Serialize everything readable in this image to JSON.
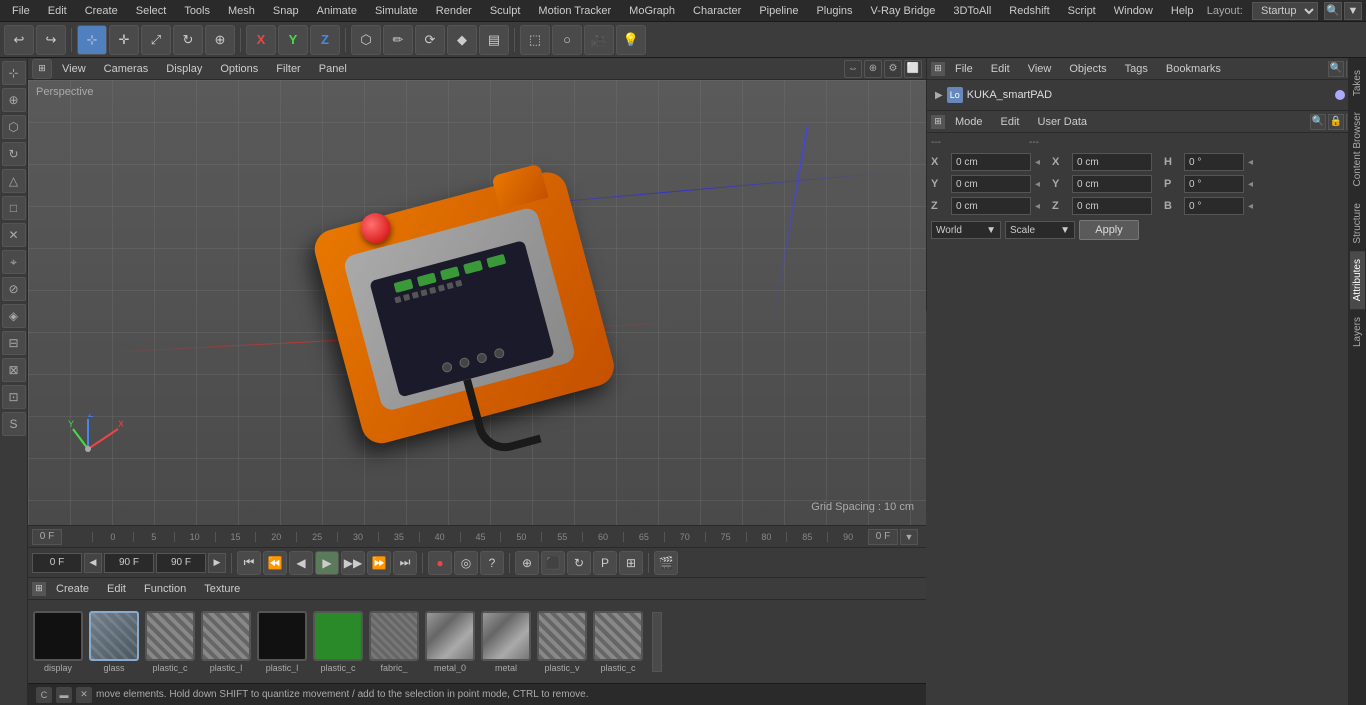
{
  "menu": {
    "items": [
      "File",
      "Edit",
      "Create",
      "Select",
      "Tools",
      "Mesh",
      "Snap",
      "Animate",
      "Simulate",
      "Render",
      "Sculpt",
      "Motion Tracker",
      "MoGraph",
      "Character",
      "Pipeline",
      "Plugins",
      "V-Ray Bridge",
      "3DToAll",
      "Redshift",
      "Script",
      "Window",
      "Help"
    ],
    "layout_label": "Layout:",
    "layout_value": "Startup"
  },
  "toolbar": {
    "undo_icon": "↩",
    "redo_icon": "↪",
    "move_icon": "✛",
    "scale_icon": "⤢",
    "rotate_icon": "↻",
    "axis_x": "X",
    "axis_y": "Y",
    "axis_z": "Z"
  },
  "viewport": {
    "label": "Perspective",
    "menu_items": [
      "View",
      "Cameras",
      "Display",
      "Options",
      "Filter",
      "Panel"
    ],
    "grid_spacing": "Grid Spacing : 10 cm"
  },
  "timeline": {
    "marks": [
      "0",
      "5",
      "10",
      "15",
      "20",
      "25",
      "30",
      "35",
      "40",
      "45",
      "50",
      "55",
      "60",
      "65",
      "70",
      "75",
      "80",
      "85",
      "90"
    ],
    "current_frame": "0 F",
    "start_frame": "0 F",
    "end_frame": "90 F",
    "end_frame2": "90 F"
  },
  "playback": {
    "frame_display": "0 F",
    "btn_start": "⏮",
    "btn_prev_key": "⏪",
    "btn_prev": "◀",
    "btn_play": "▶",
    "btn_next": "▶",
    "btn_next_key": "⏩",
    "btn_end": "⏭",
    "btn_record": "⏺",
    "btn_auto_key": "A",
    "btn_question": "?",
    "btn_move": "+",
    "btn_scale": "⬛",
    "btn_rotate": "↻",
    "btn_p": "P",
    "btn_grid": "⊞",
    "btn_render": "🎬"
  },
  "right_panel": {
    "top_menu": [
      "File",
      "Edit",
      "View",
      "Objects",
      "Tags",
      "Bookmarks"
    ],
    "object_name": "KUKA_smartPAD",
    "object_icon": "Lo",
    "dot1_color": "#aaaaff",
    "dot2_color": "#ff6666",
    "bottom_menu": [
      "Mode",
      "Edit",
      "User Data"
    ],
    "sections": {
      "empty_label": "---"
    }
  },
  "attributes": {
    "section1": "---",
    "section2": "---",
    "rows": [
      {
        "label": "X",
        "val1": "0 cm",
        "arrow": "◂",
        "label2": "X",
        "val2": "0 cm",
        "label3": "H",
        "val3": "0 °",
        "arrow2": "◂"
      },
      {
        "label": "Y",
        "val1": "0 cm",
        "arrow": "◂",
        "label2": "Y",
        "val2": "0 cm",
        "label3": "P",
        "val3": "0 °",
        "arrow2": "◂"
      },
      {
        "label": "Z",
        "val1": "0 cm",
        "arrow": "◂",
        "label2": "Z",
        "val2": "0 cm",
        "label3": "B",
        "val3": "0 °",
        "arrow2": "◂"
      }
    ],
    "world_label": "World",
    "scale_label": "Scale",
    "apply_label": "Apply"
  },
  "materials": {
    "menu_items": [
      "Create",
      "Edit",
      "Function",
      "Texture"
    ],
    "items": [
      {
        "name": "display",
        "type": "black"
      },
      {
        "name": "glass",
        "type": "glass"
      },
      {
        "name": "plastic_c",
        "type": "plastic-c"
      },
      {
        "name": "plastic_l",
        "type": "plastic-c"
      },
      {
        "name": "plastic_l",
        "type": "black"
      },
      {
        "name": "plastic_c",
        "type": "green"
      },
      {
        "name": "fabric_",
        "type": "fabric"
      },
      {
        "name": "metal_0",
        "type": "metal"
      },
      {
        "name": "metal",
        "type": "metal"
      },
      {
        "name": "plastic_v",
        "type": "plastic-c"
      },
      {
        "name": "plastic_c",
        "type": "plastic-c"
      }
    ]
  },
  "status": {
    "message": "move elements. Hold down SHIFT to quantize movement / add to the selection in point mode, CTRL to remove."
  },
  "sidebar": {
    "buttons": [
      "⬚",
      "⬡",
      "↻",
      "⊕",
      "△",
      "□",
      "✕",
      "⌖",
      "⊘",
      "◈",
      "⊟",
      "⊠",
      "⊡"
    ]
  },
  "right_tabs": [
    "Takes",
    "Content Browser",
    "Structure",
    "Attributes",
    "Layers"
  ]
}
